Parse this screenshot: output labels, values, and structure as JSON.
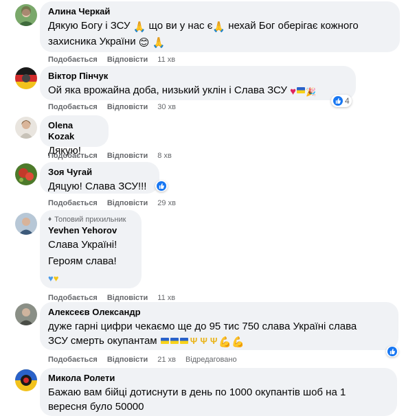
{
  "actions": {
    "like": "Подобається",
    "reply": "Відповісти",
    "edited": "Відредаговано"
  },
  "comments": [
    {
      "author": "Алина Черкай",
      "text1": "Дякую Богу і ЗСУ",
      "text2": "що ви у нас є",
      "text3": "нехай Бог оберігає кожного",
      "text4": "захисника України",
      "time": "11 хв"
    },
    {
      "author": "Віктор Пінчук",
      "text": "Ой яка врожайна доба, низький уклін і Слава ЗСУ",
      "time": "30 хв",
      "reactions": "4"
    },
    {
      "author": "Olena Kozak",
      "text": "Дякую!",
      "time": "8 хв"
    },
    {
      "author": "Зоя Чугай",
      "text": "Дяцую! Слава ЗСУ!!!",
      "time": "29 хв"
    },
    {
      "badge": "Топовий прихильник",
      "author": "Yevhen Yehorov",
      "line1": "Слава Україні!",
      "line2": "Героям слава!",
      "time": "11 хв"
    },
    {
      "author": "Алексеєв Олександр",
      "line1": "дуже гарні цифри чекаємо ще до 95 тис 750 слава Україні слава",
      "line2": "ЗСУ смерть окупантам",
      "time": "21 хв"
    },
    {
      "author": "Микола Ролети",
      "line1": "Бажаю вам бійці дотиснути в день по 1000 окупантів шоб на 1",
      "line2": "вересня було 50000"
    }
  ]
}
